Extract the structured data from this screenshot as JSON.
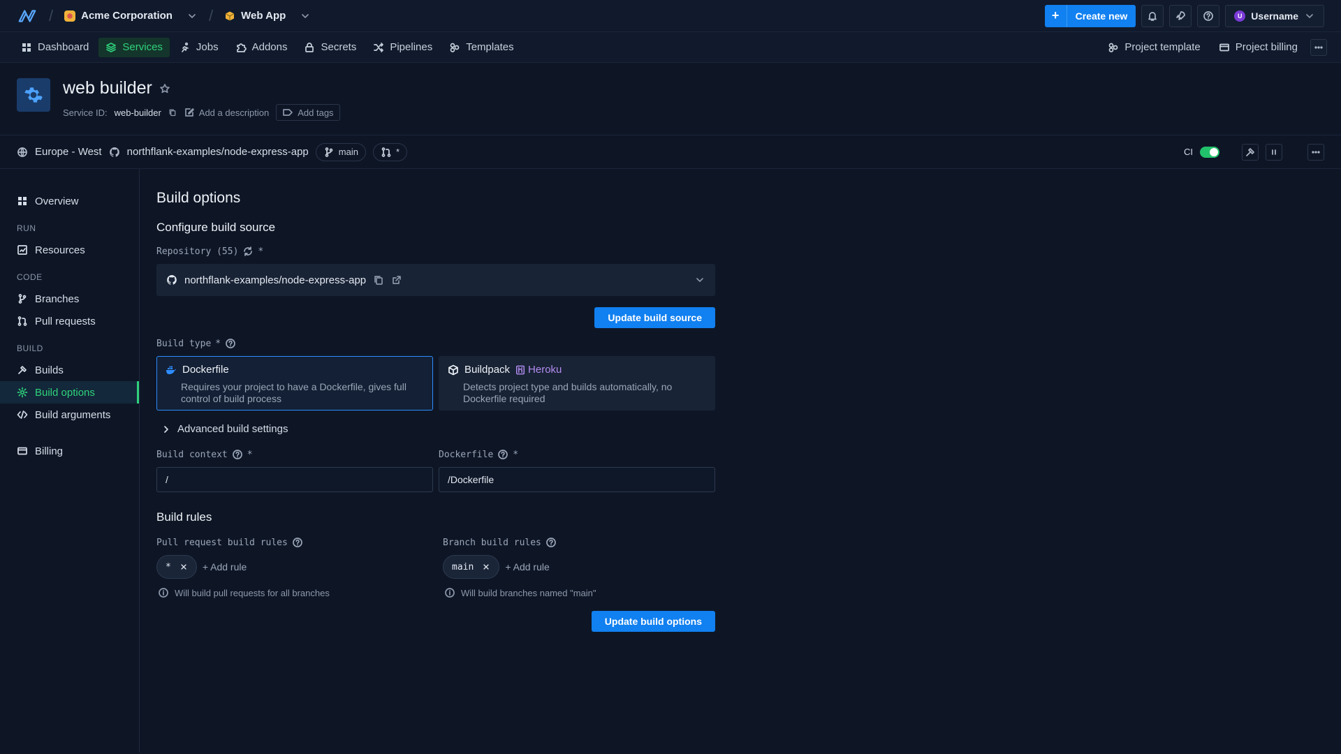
{
  "topbar": {
    "org": "Acme Corporation",
    "project": "Web App",
    "create_label": "Create new",
    "username": "Username",
    "avatar_letter": "U"
  },
  "nav": {
    "items": [
      {
        "label": "Dashboard",
        "icon": "grid-icon"
      },
      {
        "label": "Services",
        "icon": "layers-icon",
        "active": true
      },
      {
        "label": "Jobs",
        "icon": "run-icon"
      },
      {
        "label": "Addons",
        "icon": "puzzle-icon"
      },
      {
        "label": "Secrets",
        "icon": "lock-icon"
      },
      {
        "label": "Pipelines",
        "icon": "shuffle-icon"
      },
      {
        "label": "Templates",
        "icon": "template-icon"
      }
    ],
    "project_template": "Project template",
    "project_billing": "Project billing"
  },
  "service": {
    "name": "web builder",
    "id_label": "Service ID:",
    "id": "web-builder",
    "add_description": "Add a description",
    "add_tags": "Add tags"
  },
  "infobar": {
    "region": "Europe - West",
    "repo": "northflank-examples/node-express-app",
    "branch": "main",
    "pr": "*",
    "ci_label": "CI"
  },
  "sidebar": {
    "overview": "Overview",
    "run_section": "RUN",
    "resources": "Resources",
    "code_section": "CODE",
    "branches": "Branches",
    "pull_requests": "Pull requests",
    "build_section": "BUILD",
    "builds": "Builds",
    "build_options": "Build options",
    "build_arguments": "Build arguments",
    "billing": "Billing"
  },
  "main": {
    "title": "Build options",
    "configure_title": "Configure build source",
    "repository_label": "Repository (55)",
    "required_mark": "*",
    "repository_value": "northflank-examples/node-express-app",
    "update_source_btn": "Update build source",
    "build_type_label": "Build type",
    "dockerfile": {
      "title": "Dockerfile",
      "desc": "Requires your project to have a Dockerfile, gives full control of build process"
    },
    "buildpack": {
      "title": "Buildpack",
      "badge": "Heroku",
      "desc": "Detects project type and builds automatically, no Dockerfile required"
    },
    "advanced": "Advanced build settings",
    "context_label": "Build context",
    "context_value": "/",
    "dockerfile_label": "Dockerfile",
    "dockerfile_value": "/Dockerfile",
    "rules_title": "Build rules",
    "pr_rules_label": "Pull request build rules",
    "pr_rule": "*",
    "branch_rules_label": "Branch build rules",
    "branch_rule": "main",
    "add_rule": "+ Add rule",
    "pr_hint": "Will build pull requests for all branches",
    "branch_hint": "Will build branches named \"main\"",
    "update_options_btn": "Update build options"
  },
  "colors": {
    "accent": "#1180f0",
    "active_green": "#2fd27c",
    "background": "#0e1626"
  }
}
